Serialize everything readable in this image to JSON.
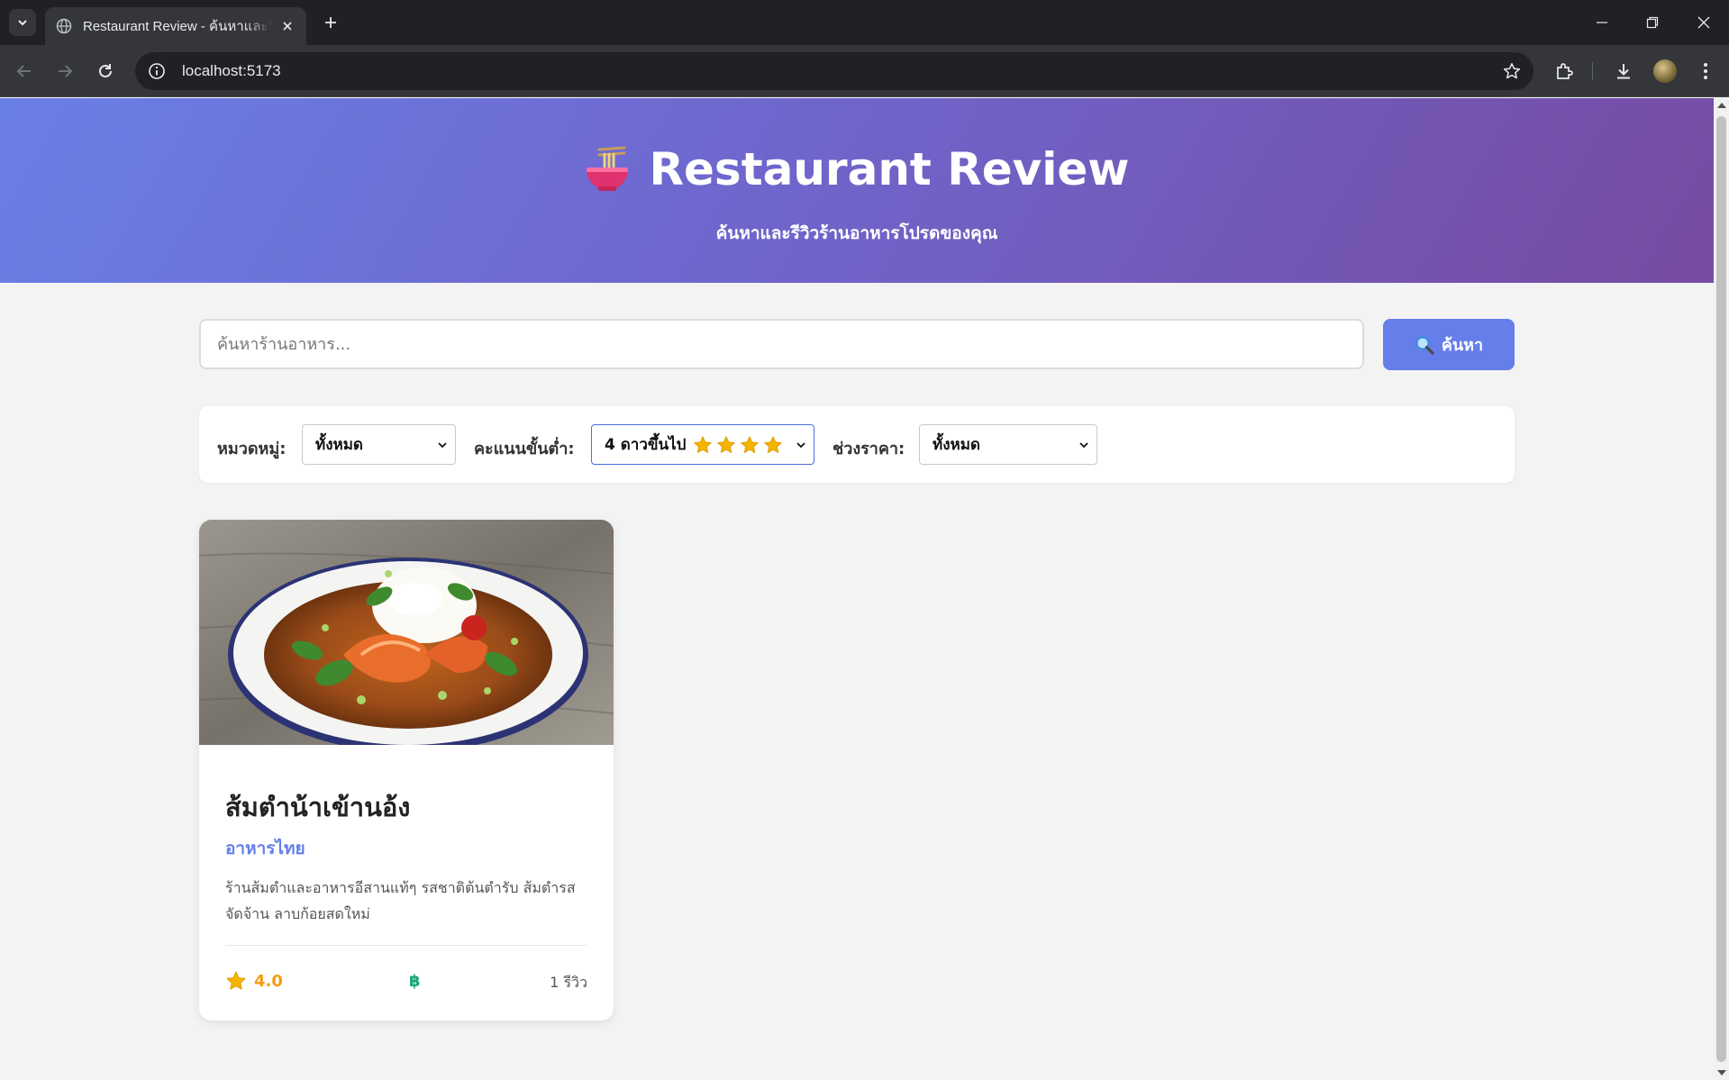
{
  "browser": {
    "tab_title": "Restaurant Review - ค้นหาและรีวิวร้านอาหาร",
    "url": "localhost:5173"
  },
  "hero": {
    "title": "Restaurant Review",
    "subtitle": "ค้นหาและรีวิวร้านอาหารโปรดของคุณ"
  },
  "search": {
    "placeholder": "ค้นหาร้านอาหาร...",
    "button_label": "ค้นหา"
  },
  "filters": {
    "category_label": "หมวดหมู่:",
    "category_value": "ทั้งหมด",
    "rating_label": "คะแนนขั้นต่ำ:",
    "rating_value": "4 ดาวขึ้นไป",
    "rating_stars": 4,
    "price_label": "ช่วงราคา:",
    "price_value": "ทั้งหมด"
  },
  "restaurants": [
    {
      "name": "ส้มตำน้าเข้านอ้ง",
      "category": "อาหารไทย",
      "description": "ร้านส้มตำและอาหารอีสานแท้ๆ รสชาติต้นตำรับ ส้มตำรสจัดจ้าน ลาบก้อยสดใหม่",
      "rating": "4.0",
      "price": "฿",
      "reviews": "1 รีวิว"
    }
  ],
  "colors": {
    "accent": "#667eea",
    "hero_gradient_start": "#6a7fe6",
    "hero_gradient_end": "#764ba2",
    "rating": "#f39c12",
    "price": "#17a673"
  }
}
